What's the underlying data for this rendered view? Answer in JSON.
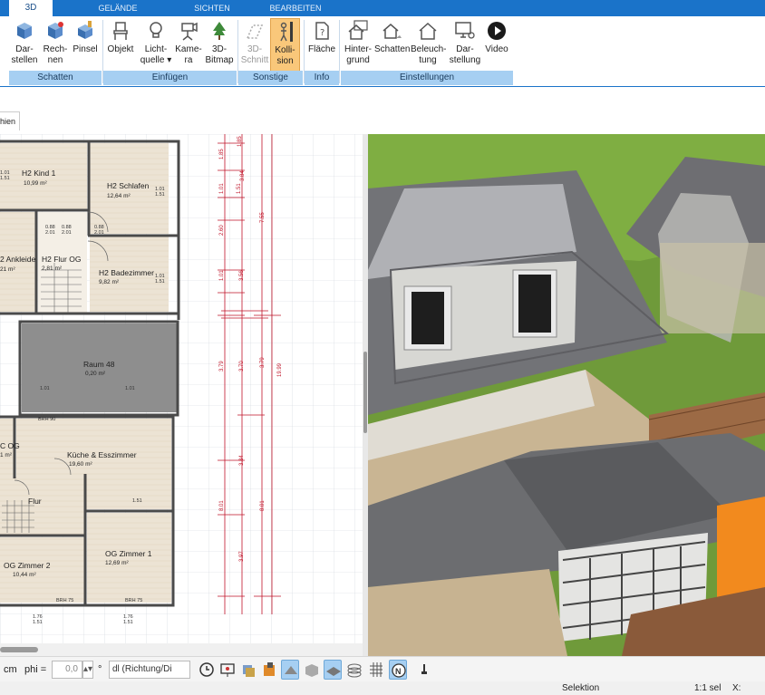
{
  "tabs": [
    {
      "label": "3D",
      "active": true
    },
    {
      "label": "GELÄNDE",
      "active": false
    },
    {
      "label": "SICHTEN",
      "active": false
    },
    {
      "label": "BEARBEITEN",
      "active": false
    }
  ],
  "ribbon": {
    "buttons": {
      "darstellen": "Dar-\nstellen",
      "rechnen": "Rech-\nnen",
      "pinsel": "Pinsel",
      "objekt": "Objekt",
      "lichtquelle": "Licht-\nquelle ▾",
      "kamera": "Kame-\nra",
      "bitmap": "3D-\nBitmap",
      "schnitt": "3D-\nSchnitt",
      "kollision": "Kolli-\nsion",
      "flaeche": "Fläche",
      "hintergrund": "Hinter-\ngrund",
      "schatten": "Schatten",
      "beleuchtung": "Beleuch-\ntung",
      "darstellung": "Dar-\nstellung",
      "video": "Video"
    },
    "groups": {
      "schatten": "Schatten",
      "einfuegen": "Einfügen",
      "sonstige": "Sonstige",
      "info": "Info",
      "einstellungen": "Einstellungen"
    }
  },
  "document_tab": "hien",
  "plan": {
    "rooms": [
      {
        "name": "H2 Kind 1",
        "area": "10,99 m²"
      },
      {
        "name": "H2 Schlafen",
        "area": "12,64 m²"
      },
      {
        "name": "2 Ankleide",
        "area": "21 m²"
      },
      {
        "name": "H2 Flur OG",
        "area": "2,81 m²"
      },
      {
        "name": "H2 Badezimmer",
        "area": "9,82 m²"
      },
      {
        "name": "Raum 48",
        "area": "0,20 m²"
      },
      {
        "name": "C OG",
        "area": "1 m²"
      },
      {
        "name": "Küche & Esszimmer",
        "area": "19,60 m²"
      },
      {
        "name": "Flur",
        "area": ""
      },
      {
        "name": "OG Zimmer 2",
        "area": "10,44 m²"
      },
      {
        "name": "OG Zimmer 1",
        "area": "12,69 m²"
      }
    ],
    "dims": [
      "1.01",
      "1.51",
      "0.88",
      "2.01",
      "1.85",
      "1.01",
      "1.51",
      "3.84",
      "2.60",
      "7.55",
      "1.01",
      "3.56",
      "3.79",
      "3.70",
      "3.79",
      "19.99",
      "3.84",
      "8.01",
      "8.01",
      "3.97",
      "1.76",
      "1.51",
      "1.76",
      "1.51"
    ],
    "labels_small": [
      "BRH 90",
      "BRH 75",
      "BRH 75"
    ]
  },
  "toolbar": {
    "unit": "cm",
    "phi_label": "phi =",
    "phi_value": "0,0",
    "degree": "°",
    "mode_select": "dl (Richtung/Di"
  },
  "status": {
    "mode": "Selektion",
    "scale": "1:1 sel",
    "x_label": "X:"
  },
  "colors": {
    "ribbon_blue": "#1a73c9",
    "group_band": "#a6cff2",
    "active_button": "#f9c77a",
    "dimension_red": "#c0152a"
  }
}
